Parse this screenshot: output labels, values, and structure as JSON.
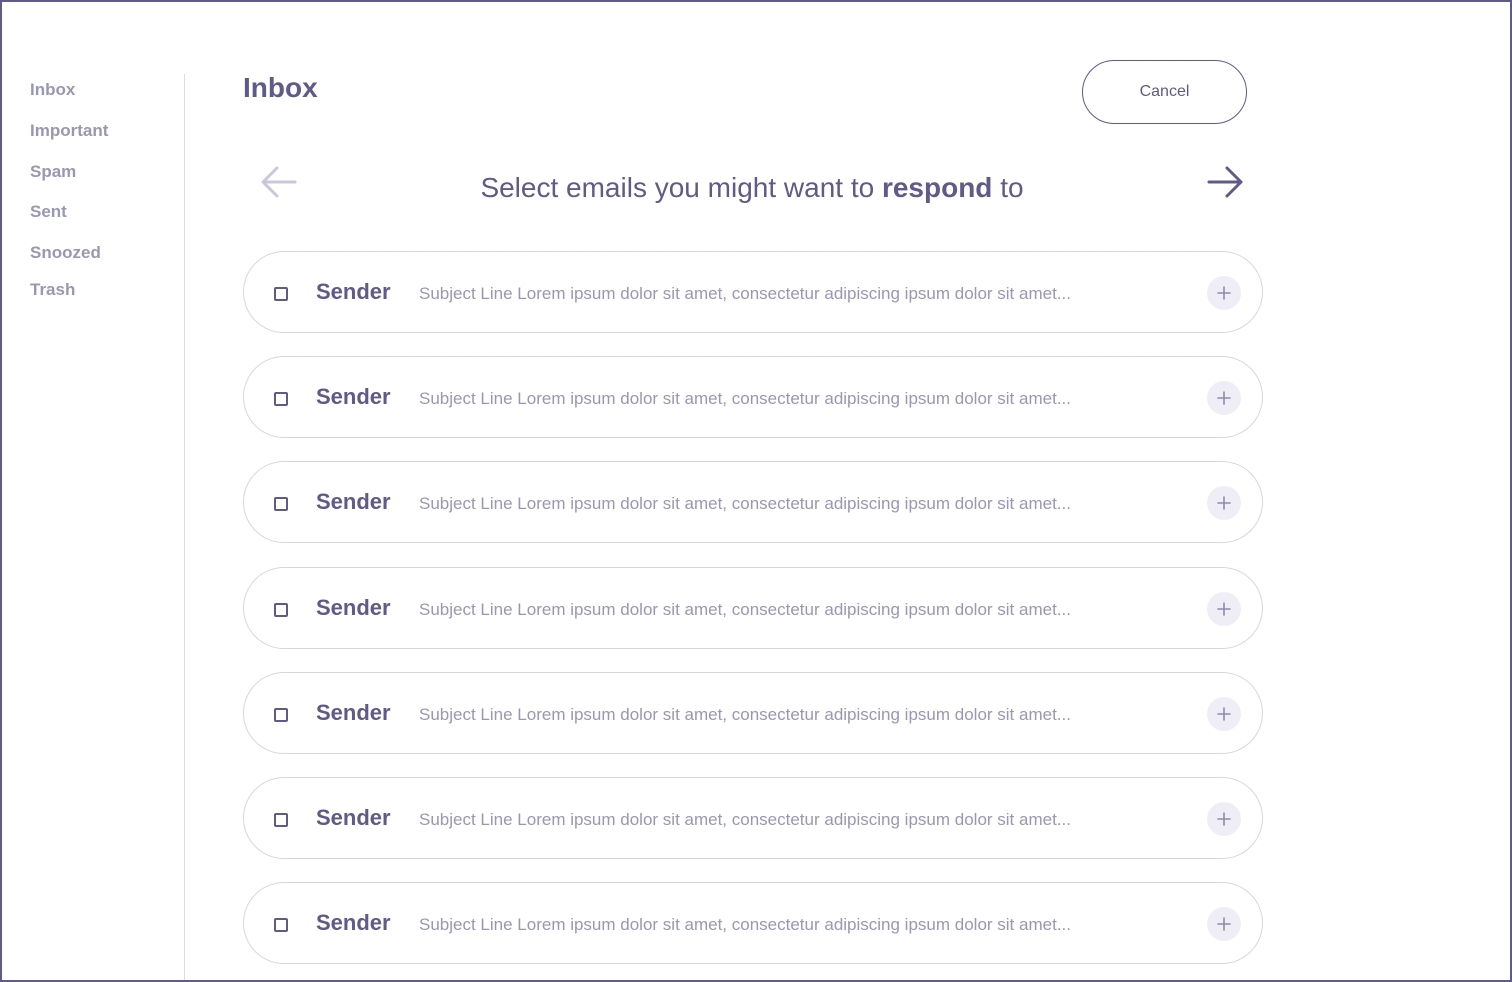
{
  "sidebar": {
    "items": [
      {
        "label": "Inbox"
      },
      {
        "label": "Important"
      },
      {
        "label": "Spam"
      },
      {
        "label": "Sent"
      },
      {
        "label": "Snoozed"
      },
      {
        "label": "Trash"
      }
    ]
  },
  "header": {
    "title": "Inbox",
    "cancel_label": "Cancel"
  },
  "prompt": {
    "before": "Select emails you might want to ",
    "emphasis": "respond",
    "after": " to"
  },
  "icons": {
    "back": "arrow-left-icon",
    "forward": "arrow-right-icon",
    "add": "plus-icon",
    "checkbox": "checkbox-unchecked"
  },
  "colors": {
    "primary": "#5f5a87",
    "muted": "#9a97b2",
    "border": "#d7d6e3",
    "add_bg": "#efeef7"
  },
  "emails": [
    {
      "sender": "Sender",
      "subject": "Subject Line Lorem ipsum dolor sit amet, consectetur adipiscing ipsum dolor sit amet..."
    },
    {
      "sender": "Sender",
      "subject": "Subject Line Lorem ipsum dolor sit amet, consectetur adipiscing ipsum dolor sit amet..."
    },
    {
      "sender": "Sender",
      "subject": "Subject Line Lorem ipsum dolor sit amet, consectetur adipiscing ipsum dolor sit amet..."
    },
    {
      "sender": "Sender",
      "subject": "Subject Line Lorem ipsum dolor sit amet, consectetur adipiscing ipsum dolor sit amet..."
    },
    {
      "sender": "Sender",
      "subject": "Subject Line Lorem ipsum dolor sit amet, consectetur adipiscing ipsum dolor sit amet..."
    },
    {
      "sender": "Sender",
      "subject": "Subject Line Lorem ipsum dolor sit amet, consectetur adipiscing ipsum dolor sit amet..."
    },
    {
      "sender": "Sender",
      "subject": "Subject Line Lorem ipsum dolor sit amet, consectetur adipiscing ipsum dolor sit amet..."
    }
  ]
}
